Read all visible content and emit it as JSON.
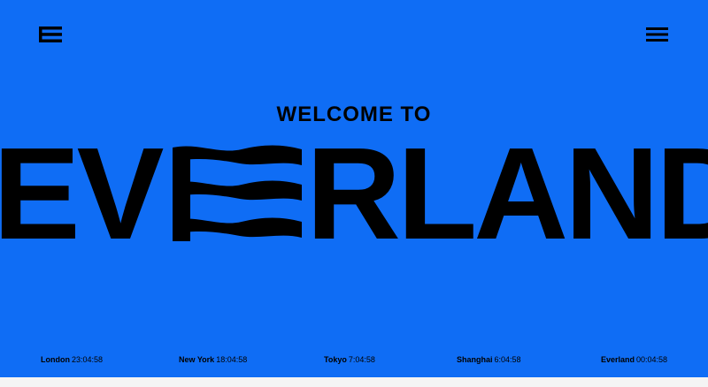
{
  "header": {
    "logo_icon": "everland-e-icon",
    "menu_icon": "hamburger-menu-icon"
  },
  "hero": {
    "welcome": "WELCOME TO",
    "wordmark_left": "EV",
    "wordmark_wave_letter": "E",
    "wordmark_right": "RLAND"
  },
  "clocks": [
    {
      "city": "London",
      "time": "23:04:58"
    },
    {
      "city": "New York",
      "time": "18:04:58"
    },
    {
      "city": "Tokyo",
      "time": "7:04:58"
    },
    {
      "city": "Shanghai",
      "time": "6:04:58"
    },
    {
      "city": "Everland",
      "time": "00:04:58"
    }
  ],
  "colors": {
    "background": "#0f6df5",
    "foreground": "#000000"
  }
}
